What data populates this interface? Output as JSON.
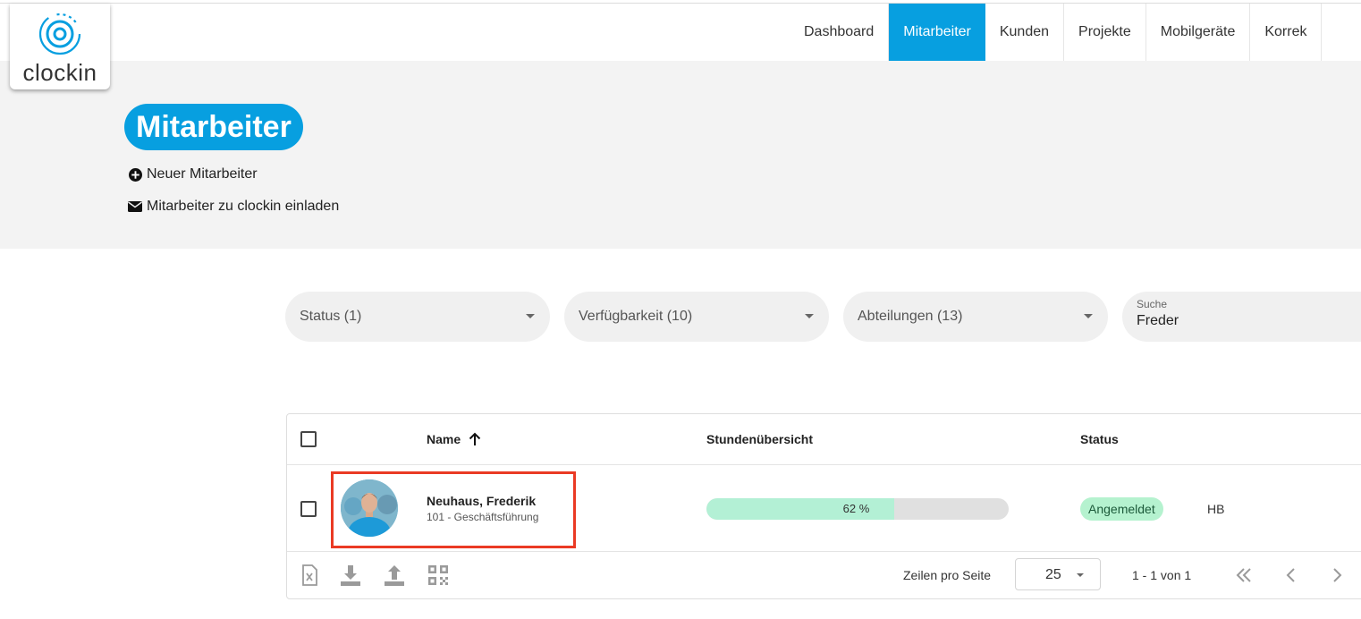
{
  "logo": {
    "text": "clockin"
  },
  "nav": [
    {
      "label": "Dashboard"
    },
    {
      "label": "Mitarbeiter"
    },
    {
      "label": "Kunden"
    },
    {
      "label": "Projekte"
    },
    {
      "label": "Mobilgeräte"
    },
    {
      "label": "Korrek"
    }
  ],
  "header": {
    "title": "Mitarbeiter",
    "new_employee": "Neuer Mitarbeiter",
    "invite": "Mitarbeiter zu clockin einladen"
  },
  "filters": {
    "status": "Status (1)",
    "availability": "Verfügbarkeit (10)",
    "departments": "Abteilungen (13)",
    "search_label": "Suche",
    "search_value": "Freder"
  },
  "table": {
    "columns": {
      "name": "Name",
      "hours": "Stundenübersicht",
      "status": "Status"
    },
    "rows": [
      {
        "name": "Neuhaus, Frederik",
        "subtitle": "101 - Geschäftsführung",
        "progress_text": "62 %",
        "progress": 0.62,
        "status": "Angemeldet",
        "short": "HB"
      }
    ],
    "footer": {
      "rows_per_page_label": "Zeilen pro Seite",
      "rows_per_page": "25",
      "range": "1 - 1 von 1"
    }
  },
  "colors": {
    "accent": "#079fe0",
    "status_chip": "#b5f2cf",
    "progress_fill": "#b3f0d5",
    "highlight": "#ea3a24"
  },
  "icons": [
    "clockin-logo-icon",
    "plus-circle-icon",
    "envelope-icon",
    "arrow-up-icon",
    "excel-export-icon",
    "download-icon",
    "upload-icon",
    "qr-code-icon",
    "first-page-icon",
    "prev-page-icon",
    "next-page-icon"
  ]
}
